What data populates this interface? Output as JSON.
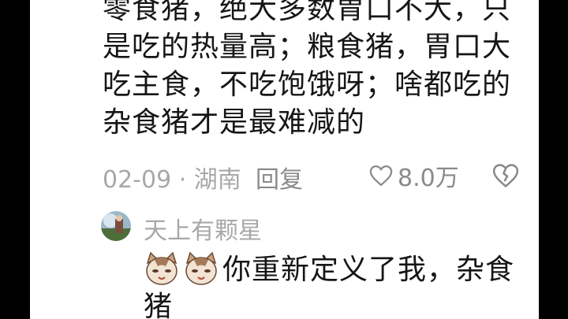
{
  "comment": {
    "lines": [
      "零食猪，绝大多数胃口不大，只",
      "是吃的热量高；粮食猪，胃口大",
      "吃主食，不吃饱饿呀；啥都吃的",
      "杂食猪才是最难减的"
    ],
    "date_location": "02-09 · 湖南",
    "reply_label": "回复",
    "like_count": "8.0万"
  },
  "reply": {
    "author": "天上有颗星",
    "text": "你重新定义了我，杂食",
    "text_line2": "猪"
  },
  "colors": {
    "meta": "#a8a8a8",
    "text": "#161616",
    "frame": "#000000"
  }
}
